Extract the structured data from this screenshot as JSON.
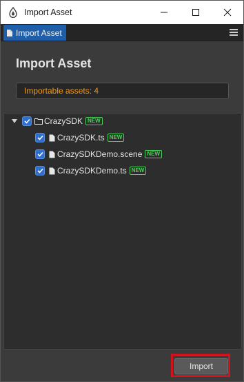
{
  "window": {
    "title": "Import Asset",
    "controls": [
      "minimize-icon",
      "maximize-icon",
      "close-icon"
    ]
  },
  "panel": {
    "tab_label": "Import Asset",
    "menu_icon": "hamburger-menu-icon"
  },
  "main": {
    "heading": "Import Asset",
    "importable_text": "Importable assets: 4"
  },
  "tree": {
    "items": [
      {
        "label": "CrazySDK",
        "badge": "NEW",
        "type": "folder",
        "checked": true,
        "expanded": true
      },
      {
        "label": "CrazySDK.ts",
        "badge": "NEW",
        "type": "file",
        "checked": true
      },
      {
        "label": "CrazySDKDemo.scene",
        "badge": "NEW",
        "type": "file",
        "checked": true
      },
      {
        "label": "CrazySDKDemo.ts",
        "badge": "NEW",
        "type": "file",
        "checked": true
      }
    ]
  },
  "footer": {
    "import_label": "Import"
  },
  "colors": {
    "accent": "#1f5ea8",
    "warning_text": "#f29a1c",
    "new_badge": "#49d05a",
    "highlight": "#d2121c"
  }
}
